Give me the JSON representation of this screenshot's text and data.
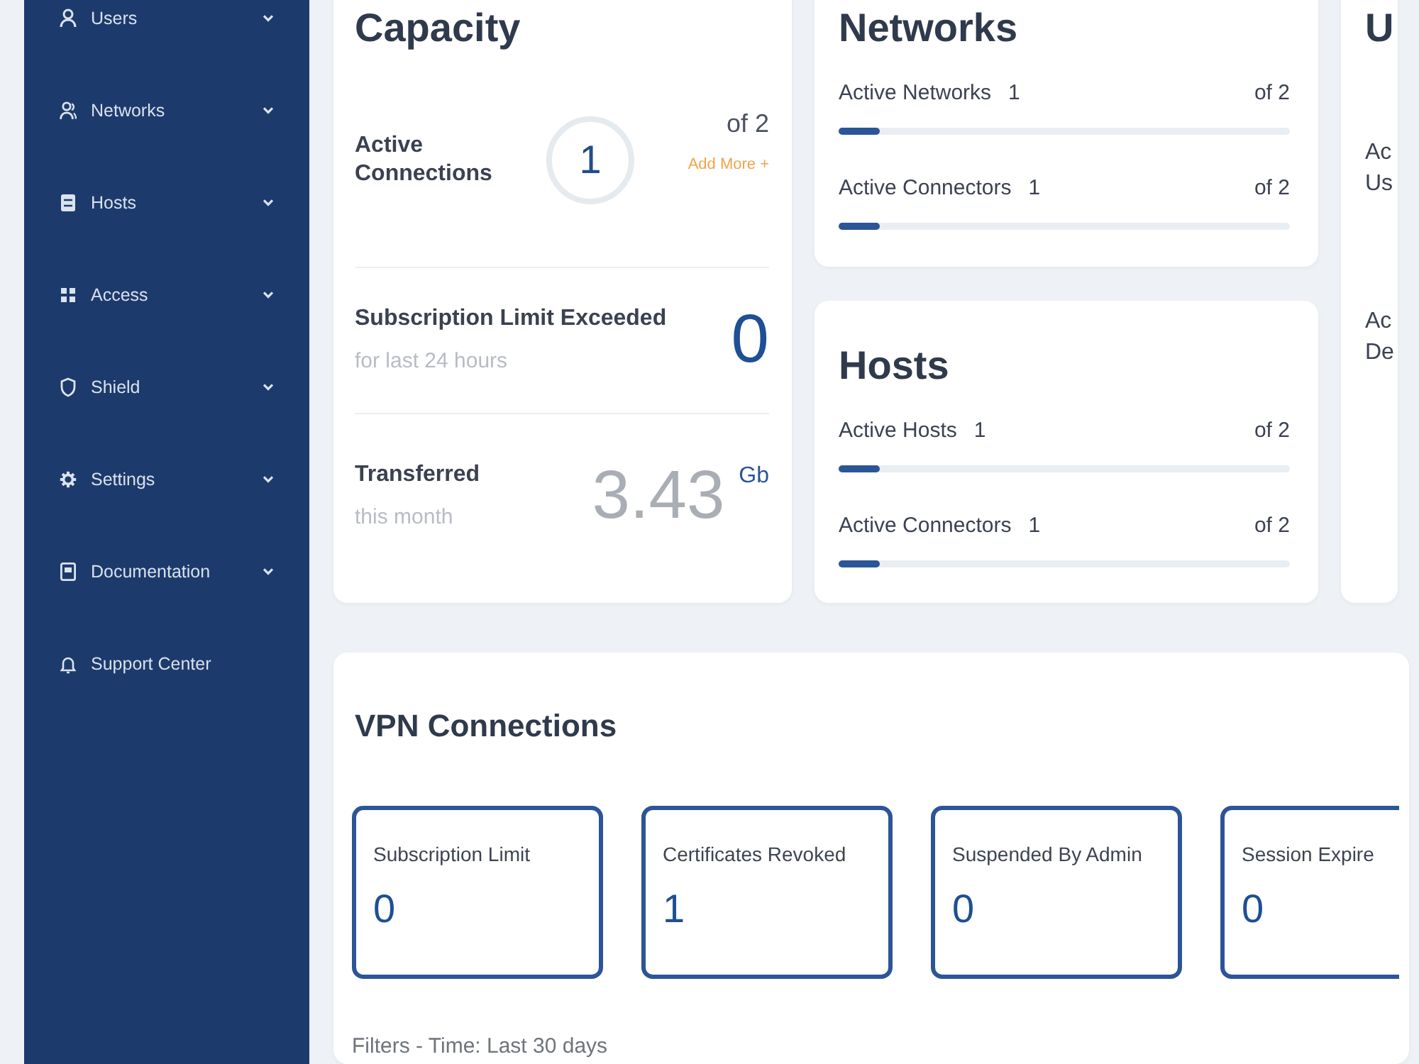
{
  "sidebar": {
    "items": [
      {
        "label": "Users",
        "kind": "group"
      },
      {
        "label": "Networks",
        "kind": "group"
      },
      {
        "label": "Hosts",
        "kind": "group"
      },
      {
        "label": "Access",
        "kind": "group"
      },
      {
        "label": "Shield",
        "kind": "group"
      },
      {
        "label": "Settings",
        "kind": "group"
      },
      {
        "label": "Documentation",
        "kind": "group"
      },
      {
        "label": "Support Center",
        "kind": "link"
      }
    ]
  },
  "capacity": {
    "title": "Capacity",
    "active_connections": {
      "label": "Active Connections",
      "value": "1",
      "total": "of 2",
      "add_more": "Add More +"
    },
    "limit_exceeded": {
      "label": "Subscription Limit Exceeded",
      "sublabel": "for last 24 hours",
      "value": "0"
    },
    "transferred": {
      "label": "Transferred",
      "sublabel": "this month",
      "value": "3.43",
      "unit": "Gb"
    }
  },
  "networks": {
    "title": "Networks",
    "meters": [
      {
        "label": "Active Networks",
        "value": "1",
        "total": "of 2",
        "level": 0.09
      },
      {
        "label": "Active Connectors",
        "value": "1",
        "total": "of 2",
        "level": 0.09
      }
    ]
  },
  "hosts": {
    "title": "Hosts",
    "meters": [
      {
        "label": "Active Hosts",
        "value": "1",
        "total": "of 2",
        "level": 0.09
      },
      {
        "label": "Active Connectors",
        "value": "1",
        "total": "of 2",
        "level": 0.09
      }
    ]
  },
  "users": {
    "title": "U",
    "rows": [
      {
        "lines": [
          "Ac",
          "Us"
        ]
      },
      {
        "lines": [
          "Ac",
          "De"
        ]
      }
    ]
  },
  "vpn_connections": {
    "title": "VPN Connections",
    "stats": [
      {
        "label": "Subscription Limit",
        "value": "0"
      },
      {
        "label": "Certificates Revoked",
        "value": "1"
      },
      {
        "label": "Suspended By Admin",
        "value": "0"
      },
      {
        "label": "Session Expire",
        "value": "0"
      }
    ],
    "filters": "Filters - Time: Last 30 days"
  }
}
